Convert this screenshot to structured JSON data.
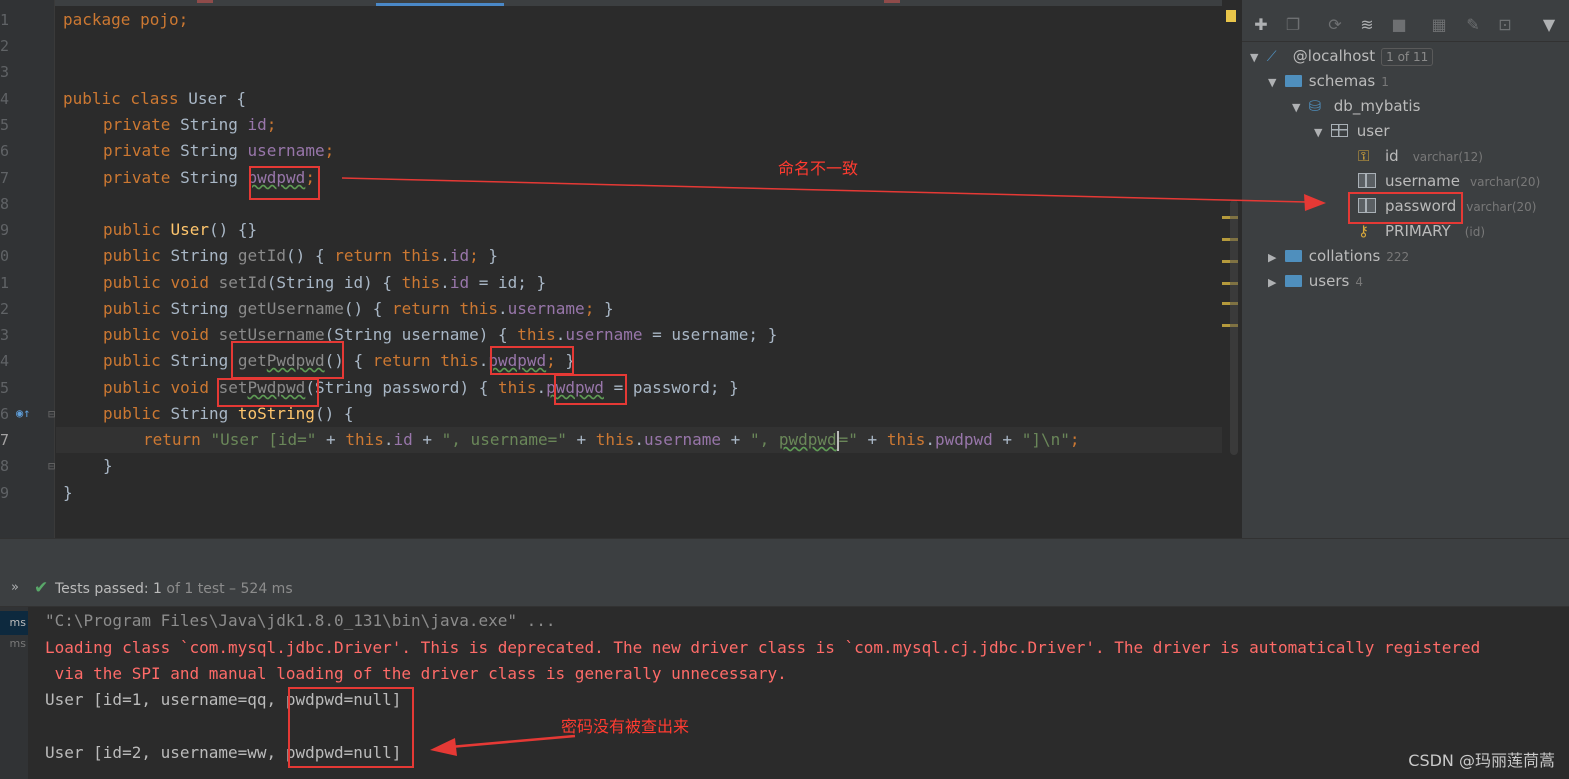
{
  "editor": {
    "line_numbers": [
      "1",
      "2",
      "3",
      "4",
      "5",
      "6",
      "7",
      "8",
      "9",
      "0",
      "1",
      "2",
      "3",
      "4",
      "5",
      "6",
      "7",
      "8",
      "9"
    ],
    "code": {
      "l1_kw": "package",
      "l1_rest": " pojo;",
      "l4_kw": "public class",
      "l4_rest": " User {",
      "private": "private",
      "public": "public",
      "string_type": "String",
      "void": "void",
      "return": "return",
      "this": "this",
      "f_id": "id",
      "f_username": "username",
      "f_pwdpwd": "pwdpwd",
      "semicolon": ";",
      "m_user": "User",
      "m_user_rest": "() {}",
      "m_getId": "getId",
      "m_setId": "setId",
      "m_getUsername": "getUsername",
      "m_setUsername": "setUsername",
      "m_getPwdpwd_a": "get",
      "m_getPwdpwd_b": "Pwdpwd",
      "m_setPwdpwd_a": "set",
      "m_setPwdpwd_b": "Pwdpwd",
      "m_toString": "toString",
      "p_id": "(String id) { ",
      "p_username": "(String username) { ",
      "p_password": "(String password) { ",
      "empty_parens_open": "() { ",
      "close": " }",
      "assign_id": " = id; ",
      "assign_username": " = username; ",
      "assign_password": " = password; ",
      "ret_s1": "\"User [id=\"",
      "ret_s2": "\", username=\"",
      "ret_s3a": "\", ",
      "ret_s3b": "pwdpwd",
      "ret_s3c": "=\"",
      "ret_s4": "\"]\\n\"",
      "plus": " + ",
      "brace_open": " {",
      "brace_close": "}"
    }
  },
  "db_panel": {
    "toolbar_icons": [
      "plus-icon",
      "copy-icon",
      "refresh-icon",
      "schema-sync-icon",
      "stop-icon",
      "table-view-icon",
      "edit-icon",
      "query-console-icon",
      "filter-icon"
    ],
    "tree": {
      "host": "@localhost",
      "host_badge": "1 of 11",
      "schemas": "schemas",
      "schemas_count": "1",
      "db": "db_mybatis",
      "table": "user",
      "col_id": "id",
      "col_id_type": "varchar(12)",
      "col_username": "username",
      "col_username_type": "varchar(20)",
      "col_password": "password",
      "col_password_type": "varchar(20)",
      "key": "PRIMARY",
      "key_hint": "(id)",
      "collations": "collations",
      "collations_count": "222",
      "users": "users",
      "users_count": "4"
    }
  },
  "run": {
    "status_main": "Tests passed: ",
    "status_count": "1",
    "status_sub": " of 1 test – 524 ms",
    "side_ms": "ms",
    "side_ms2": "ms"
  },
  "console": {
    "line1": "\"C:\\Program Files\\Java\\jdk1.8.0_131\\bin\\java.exe\" ...",
    "line2": "Loading class `com.mysql.jdbc.Driver'. This is deprecated. The new driver class is `com.mysql.cj.jdbc.Driver'. The driver is automatically registered",
    "line3": " via the SPI and manual loading of the driver class is generally unnecessary.",
    "line4": "User [id=1, username=qq, pwdpwd=null]",
    "line5": "User [id=2, username=ww, pwdpwd=null]"
  },
  "annotations": {
    "naming_mismatch": "命名不一致",
    "password_not_found": "密码没有被查出来",
    "watermark": "CSDN @玛丽莲茼蒿"
  },
  "colors": {
    "annotation_red": "#e53935",
    "keyword": "#cc7832",
    "field": "#9876aa",
    "method": "#ffc66d",
    "string": "#6a8759"
  }
}
